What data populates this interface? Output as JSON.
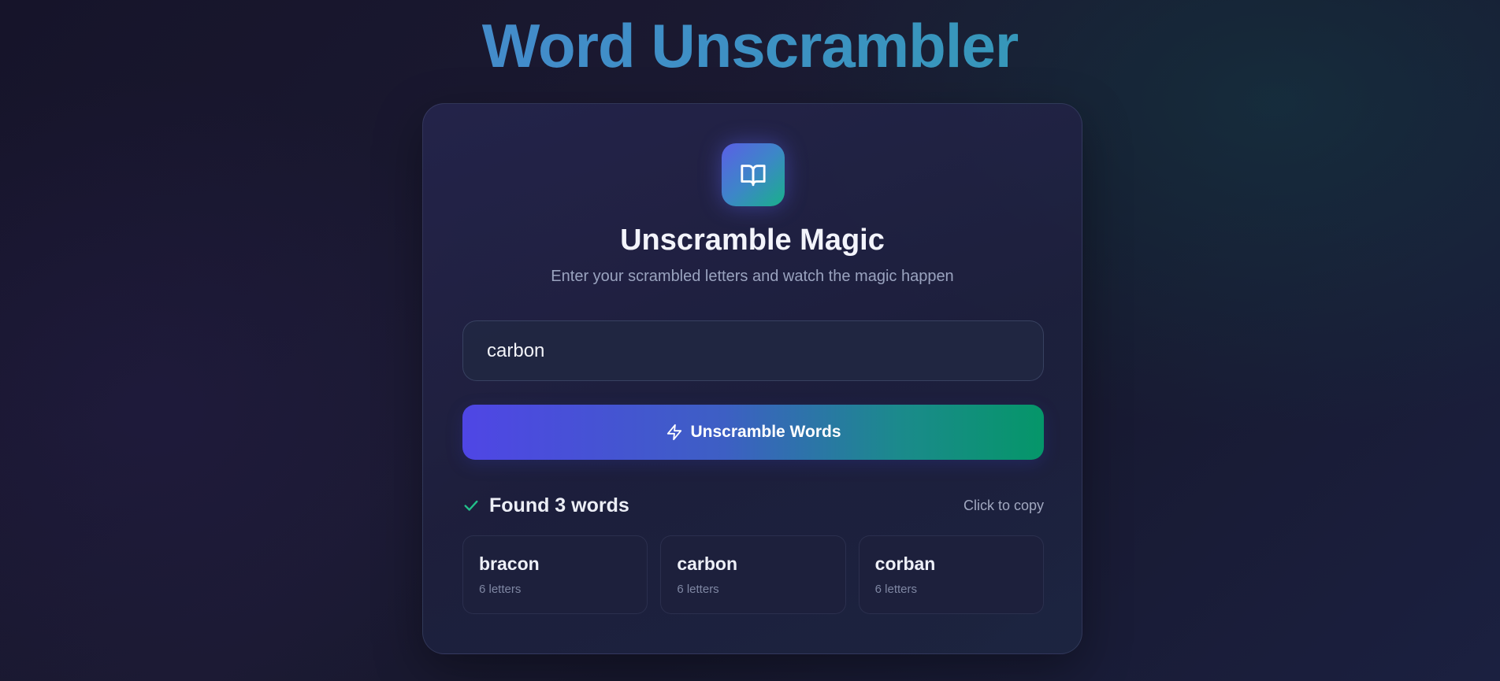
{
  "app": {
    "title": "Word Unscrambler"
  },
  "card": {
    "heading": "Unscramble Magic",
    "subheading": "Enter your scrambled letters and watch the magic happen",
    "icon": "book-open-icon"
  },
  "input": {
    "value": "carbon",
    "placeholder": ""
  },
  "button": {
    "label": "Unscramble Words",
    "icon": "lightning-icon"
  },
  "results": {
    "icon": "checkmark-icon",
    "count_label": "Found 3 words",
    "copy_hint": "Click to copy",
    "words": [
      {
        "word": "bracon",
        "length_label": "6 letters"
      },
      {
        "word": "carbon",
        "length_label": "6 letters"
      },
      {
        "word": "corban",
        "length_label": "6 letters"
      }
    ]
  },
  "colors": {
    "accent_indigo": "#4f46e5",
    "accent_green": "#059669",
    "check_green": "#22c08a",
    "background": "#181a30"
  }
}
